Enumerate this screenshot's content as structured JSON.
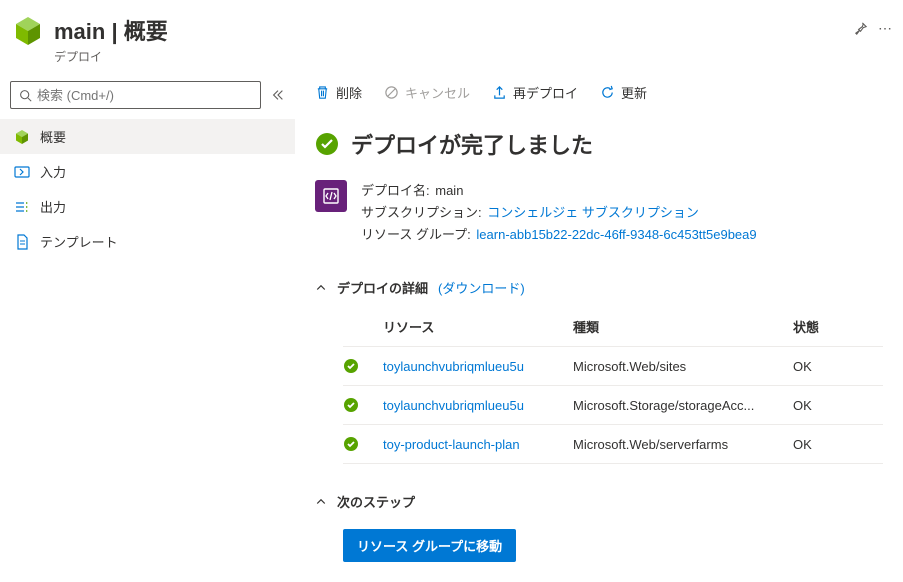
{
  "header": {
    "title": "main | 概要",
    "subtitle": "デプロイ"
  },
  "search": {
    "placeholder": "検索 (Cmd+/)"
  },
  "nav": {
    "items": [
      {
        "label": "概要"
      },
      {
        "label": "入力"
      },
      {
        "label": "出力"
      },
      {
        "label": "テンプレート"
      }
    ]
  },
  "toolbar": {
    "delete": "削除",
    "cancel": "キャンセル",
    "redeploy": "再デプロイ",
    "refresh": "更新"
  },
  "status": {
    "title": "デプロイが完了しました"
  },
  "info": {
    "deploy_name_label": "デプロイ名:",
    "deploy_name": "main",
    "subscription_label": "サブスクリプション:",
    "subscription": "コンシェルジェ サブスクリプション",
    "resource_group_label": "リソース グループ:",
    "resource_group": "learn-abb15b22-22dc-46ff-9348-6c453tt5e9bea9"
  },
  "details": {
    "title": "デプロイの詳細",
    "download": "(ダウンロード)",
    "columns": {
      "resource": "リソース",
      "type": "種類",
      "status": "状態"
    },
    "rows": [
      {
        "resource": "toylaunchvubriqmlueu5u",
        "type": "Microsoft.Web/sites",
        "status": "OK"
      },
      {
        "resource": "toylaunchvubriqmlueu5u",
        "type": "Microsoft.Storage/storageAcc...",
        "status": "OK"
      },
      {
        "resource": "toy-product-launch-plan",
        "type": "Microsoft.Web/serverfarms",
        "status": "OK"
      }
    ]
  },
  "next_steps": {
    "title": "次のステップ",
    "goto_rg": "リソース グループに移動"
  }
}
